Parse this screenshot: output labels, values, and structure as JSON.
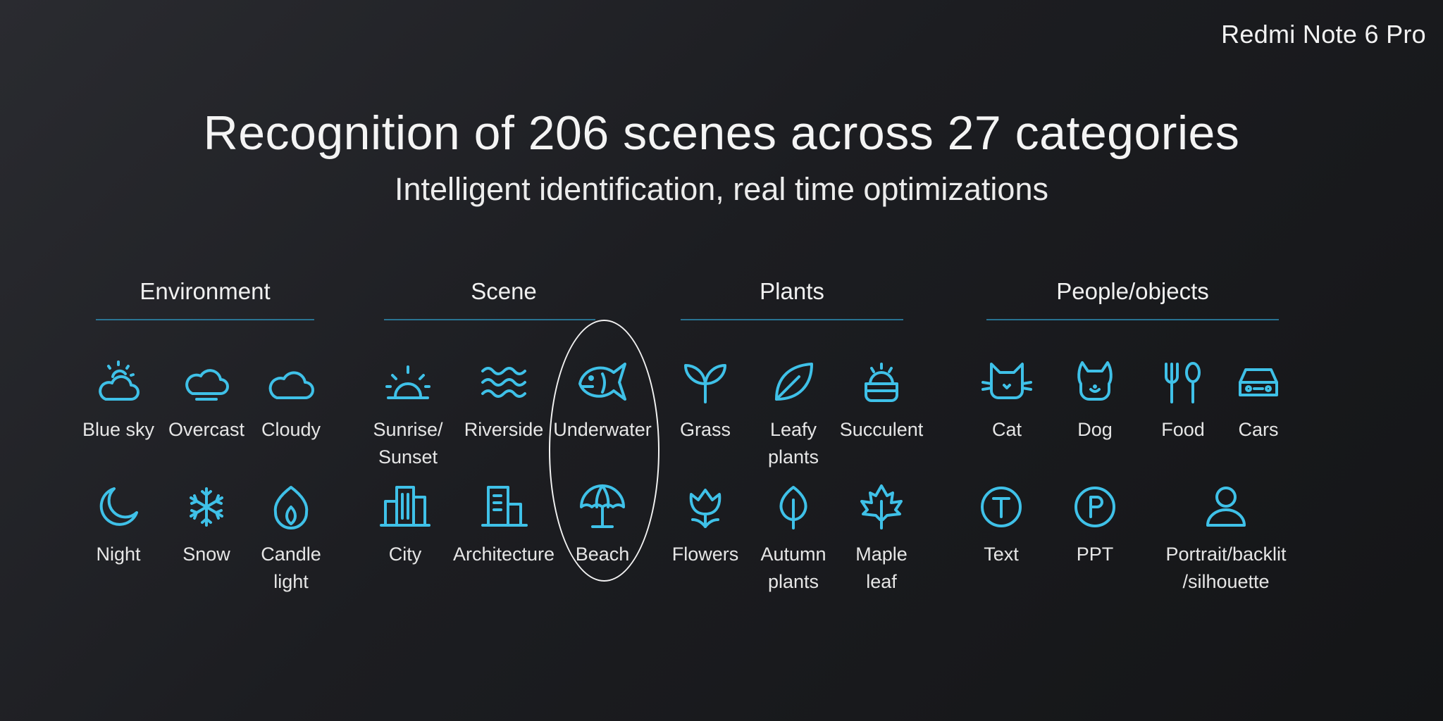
{
  "brand": "Redmi Note 6 Pro",
  "title": "Recognition of 206 scenes across 27 categories",
  "subtitle": "Intelligent identification, real time optimizations",
  "accent_color": "#3fc1e8",
  "categories": [
    {
      "name": "Environment",
      "items": [
        {
          "label": "Blue sky",
          "icon": "sun-cloud-icon"
        },
        {
          "label": "Overcast",
          "icon": "overcast-icon"
        },
        {
          "label": "Cloudy",
          "icon": "cloud-icon"
        },
        {
          "label": "Night",
          "icon": "moon-icon"
        },
        {
          "label": "Snow",
          "icon": "snowflake-icon"
        },
        {
          "label": "Candle\nlight",
          "icon": "flame-icon"
        }
      ]
    },
    {
      "name": "Scene",
      "items": [
        {
          "label": "Sunrise/\nSunset",
          "icon": "sunrise-icon"
        },
        {
          "label": "Riverside",
          "icon": "waves-icon"
        },
        {
          "label": "Underwater",
          "icon": "fish-icon"
        },
        {
          "label": "City",
          "icon": "buildings-icon"
        },
        {
          "label": "Architecture",
          "icon": "building-icon"
        },
        {
          "label": "Beach",
          "icon": "umbrella-icon"
        }
      ]
    },
    {
      "name": "Plants",
      "items": [
        {
          "label": "Grass",
          "icon": "sprout-icon"
        },
        {
          "label": "Leafy\nplants",
          "icon": "leaf-icon"
        },
        {
          "label": "Succulent",
          "icon": "succulent-icon"
        },
        {
          "label": "Flowers",
          "icon": "tulip-icon"
        },
        {
          "label": "Autumn\nplants",
          "icon": "tree-leaf-icon"
        },
        {
          "label": "Maple\nleaf",
          "icon": "maple-leaf-icon"
        }
      ]
    },
    {
      "name": "People/objects",
      "items": [
        {
          "label": "Cat",
          "icon": "cat-icon"
        },
        {
          "label": "Dog",
          "icon": "dog-icon"
        },
        {
          "label": "Food",
          "icon": "fork-spoon-icon"
        },
        {
          "label": "Cars",
          "icon": "car-icon"
        },
        {
          "label": "Text",
          "icon": "text-circle-icon"
        },
        {
          "label": "PPT",
          "icon": "ppt-circle-icon"
        },
        {
          "label": "Portrait/backlit\n/silhouette",
          "icon": "person-icon"
        }
      ]
    }
  ]
}
